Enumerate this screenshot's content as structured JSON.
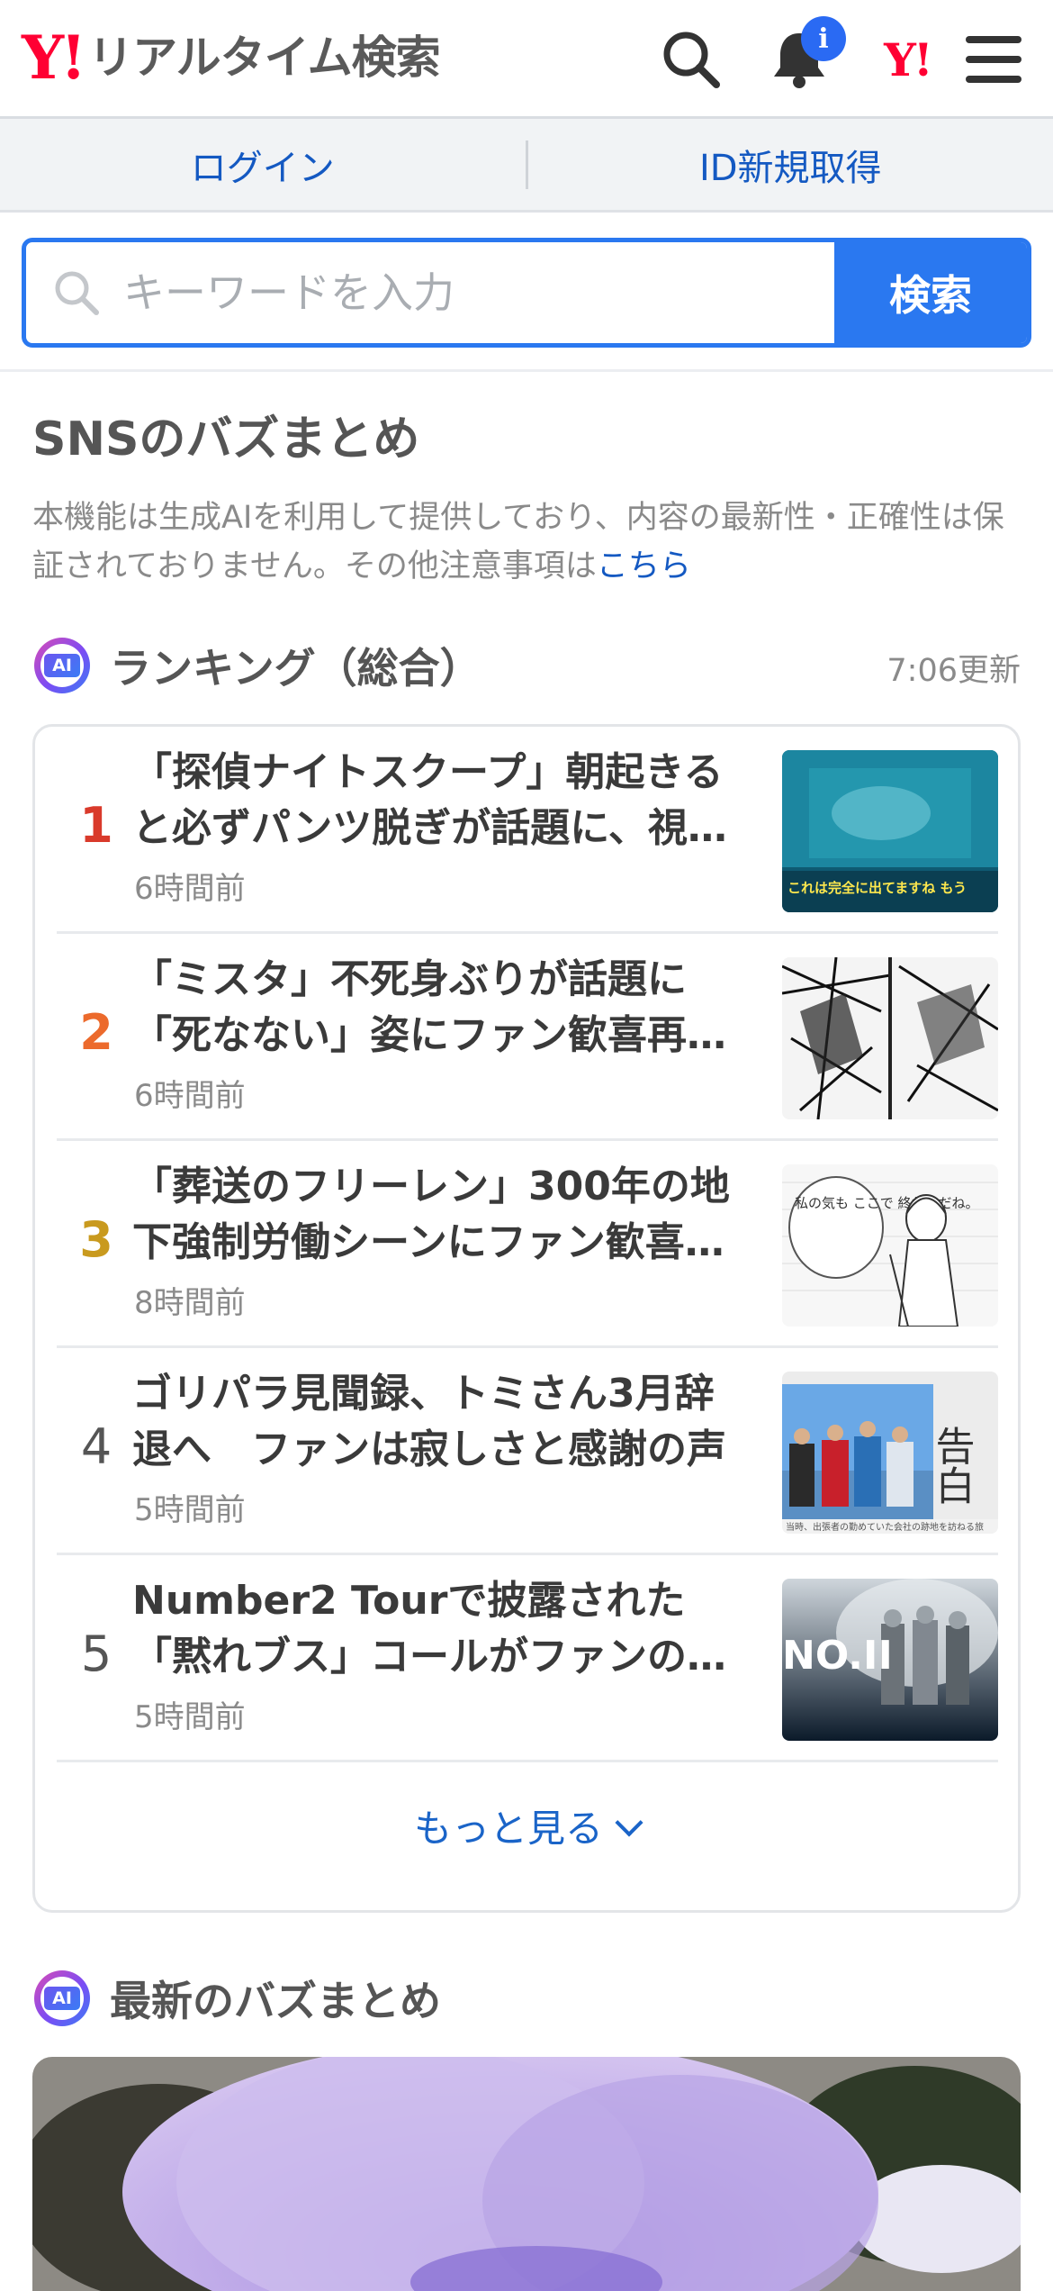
{
  "header": {
    "logo_mark": "Y!",
    "logo_text": "リアルタイム検索",
    "notification_badge": "i",
    "yj_mark": "Y!"
  },
  "loginbar": {
    "login": "ログイン",
    "register": "ID新規取得"
  },
  "search": {
    "placeholder": "キーワードを入力",
    "button": "検索"
  },
  "sns": {
    "title": "SNSのバズまとめ",
    "notice": "本機能は生成AIを利用して提供しており、内容の最新性・正確性は保証されておりません。その他注意事項は",
    "notice_link": "こちら"
  },
  "ranking": {
    "ai_label": "AI",
    "title": "ランキング（総合）",
    "updated": "7:06更新",
    "items": [
      {
        "rank": "1",
        "title": "「探偵ナイトスクープ」朝起きると必ずパンツ脱ぎが話題に、視…",
        "time": "6時間前",
        "rank_color": "#d93a2b"
      },
      {
        "rank": "2",
        "title": "「ミスタ」不死身ぶりが話題に「死なない」姿にファン歓喜再…",
        "time": "6時間前",
        "rank_color": "#ec6a2c"
      },
      {
        "rank": "3",
        "title": "「葬送のフリーレン」300年の地下強制労働シーンにファン歓喜…",
        "time": "8時間前",
        "rank_color": "#c99a1e"
      },
      {
        "rank": "4",
        "title": "ゴリパラ見聞録、トミさん3月辞退へ　ファンは寂しさと感謝の声",
        "time": "5時間前",
        "rank_color": "#555555"
      },
      {
        "rank": "5",
        "title": "Number2 Tourで披露された「黙れブス」コールがファンの…",
        "time": "5時間前",
        "rank_color": "#555555"
      }
    ],
    "more": "もっと見る"
  },
  "latest": {
    "ai_label": "AI",
    "title": "最新のバズまとめ"
  },
  "thumbs": {
    "t1_caption": "これは完全に出てますね もう",
    "t3_speech": "私の気も ここで 終わりだね。",
    "t4_kanji": "告白",
    "t4_caption": "当時、出張者の勤めていた会社の跡地を訪ねる旅",
    "t5_logo": "NO.II"
  }
}
